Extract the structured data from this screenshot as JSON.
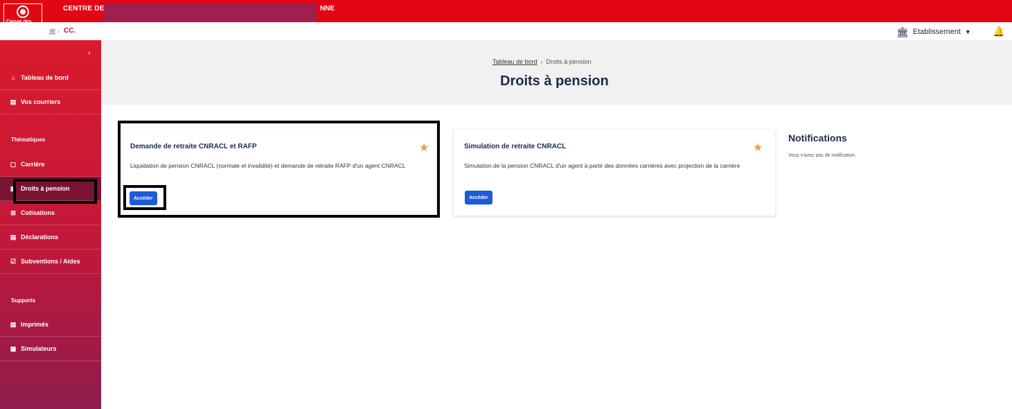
{
  "header": {
    "logo_text": "Caisse des Dépôts",
    "logo_sub": "GROUPE",
    "title_start": "CENTRE DE GES",
    "title_end": "NNE",
    "crumb_home_icon": "bank-icon",
    "crumb_sep": "›",
    "crumb_code": "CC.",
    "etablissement_label": "Etablissement",
    "etablissement_icon": "bank-icon",
    "caret_icon": "▼",
    "bell_icon": "bell-icon"
  },
  "sidebar": {
    "collapse_icon": "‹",
    "items_top": [
      {
        "label": "Tableau de bord",
        "icon": "⌂"
      },
      {
        "label": "Vos courriers",
        "icon": "▤"
      }
    ],
    "section_thematiques": "Thématiques",
    "items_thematiques": [
      {
        "label": "Carrière",
        "icon": "▢"
      },
      {
        "label": "Droits à pension",
        "icon": "▣"
      },
      {
        "label": "Cotisations",
        "icon": "⊞"
      },
      {
        "label": "Déclarations",
        "icon": "▤"
      },
      {
        "label": "Subventions / Aides",
        "icon": "☑"
      }
    ],
    "section_supports": "Supports",
    "items_supports": [
      {
        "label": "Imprimés",
        "icon": "▤"
      },
      {
        "label": "Simulateurs",
        "icon": "▦"
      }
    ]
  },
  "page": {
    "breadcrumb_link": "Tableau de bord",
    "breadcrumb_sep": "›",
    "breadcrumb_current": "Droits à pension",
    "title": "Droits à pension"
  },
  "cards": [
    {
      "title": "Demande de retraite CNRACL et RAFP",
      "description": "Liquidation de pension CNRACL (normale et invalidité) et demande de retraite RAFP d'un agent CNRACL",
      "button": "Accéder",
      "star": "★"
    },
    {
      "title": "Simulation de retraite CNRACL",
      "description": "Simulation de la pension CNRACL d'un agent à partir des données carrières avec projection de la carrière",
      "button": "Accéder",
      "star": "★"
    }
  ],
  "notifications": {
    "title": "Notifications",
    "empty_text": "Vous n'avez pas de notification."
  },
  "colors": {
    "brand_red": "#e30613",
    "primary_blue": "#1c5bd9",
    "star_orange": "#f2994a",
    "title_navy": "#1a2b4c"
  }
}
